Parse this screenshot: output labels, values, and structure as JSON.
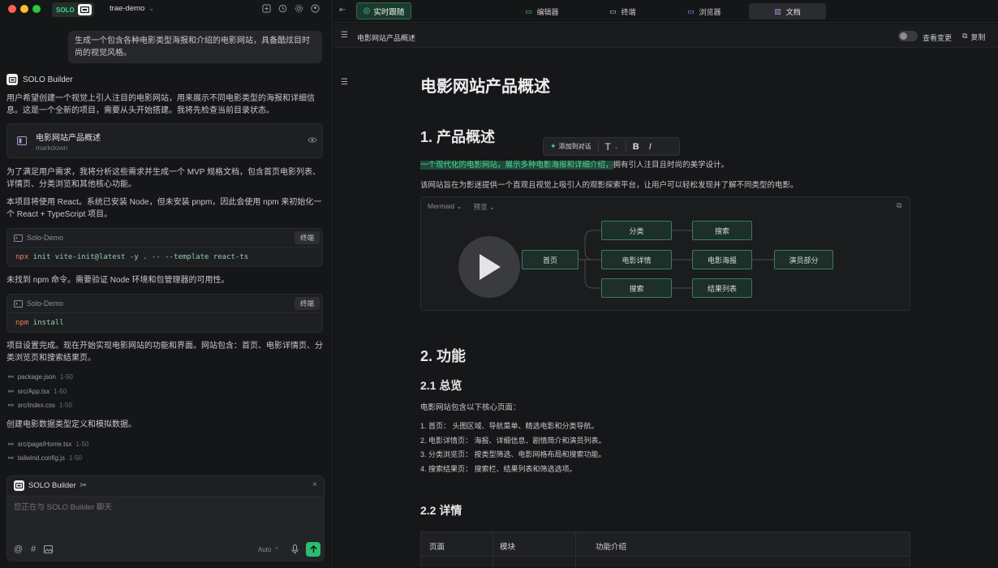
{
  "window": {
    "badge": "SOLO",
    "project": "trae-demo"
  },
  "chat": {
    "user_message": "生成一个包含各种电影类型海报和介绍的电影网站，具备酷炫目时尚的视觉风格。",
    "builder_name": "SOLO Builder",
    "msg1": "用户希望创建一个视觉上引人注目的电影网站，用来展示不同电影类型的海报和详细信息。这是一个全新的项目，需要从头开始搭建。我将先检查当前目录状态。",
    "doc_card": {
      "title": "电影网站产品概述",
      "sub": "markdown"
    },
    "msg2": "为了满足用户需求，我将分析这些需求并生成一个 MVP 规格文档，包含首页电影列表、详情页、分类浏览和其他核心功能。",
    "msg3": "本项目将使用 React。系统已安装 Node，但未安装 pnpm，因此会使用 npm 来初始化一个 React + TypeScript 项目。",
    "term1": {
      "name": "Solo-Demo",
      "btn": "终端",
      "cmd_a": "npx",
      "cmd_b": "init vite-init@latest -y . -- --template react-ts"
    },
    "msg4": "未找到 npm 命令。需要验证 Node 环境和包管理器的可用性。",
    "term2": {
      "name": "Solo-Demo",
      "btn": "终端",
      "cmd_a": "npm",
      "cmd_b": "install"
    },
    "msg5": "项目设置完成。现在开始实现电影网站的功能和界面。网站包含：首页、电影详情页、分类浏览页和搜索结果页。",
    "files1": [
      {
        "name": "package.json",
        "lines": "1-50"
      },
      {
        "name": "src/App.tsx",
        "lines": "1-50"
      },
      {
        "name": "src/index.css",
        "lines": "1-50"
      }
    ],
    "msg6": "创建电影数据类型定义和模拟数据。",
    "files2": [
      {
        "name": "src/page/Home.tsx",
        "lines": "1-50"
      },
      {
        "name": "tailwind.config.js",
        "lines": "1-50"
      }
    ],
    "composer": {
      "agent": "SOLO Builder",
      "placeholder": "您正在与 SOLO Builder 聊天",
      "mode": "Auto"
    }
  },
  "right": {
    "live_btn": "实时跟随",
    "tabs": [
      "编辑器",
      "终端",
      "浏览器",
      "文档"
    ],
    "active_tab": 3,
    "doc_title": "电影网站产品概述",
    "view_changes": "查看变更",
    "copy": "复制"
  },
  "doc": {
    "h1": "电影网站产品概述",
    "s1": "1. 产品概述",
    "toolbar": {
      "add": "添加到对话",
      "t": "T",
      "b": "B",
      "i": "I"
    },
    "p1_highlight": "一个现代化的电影网站，展示多种电影海报和详细介绍，",
    "p1_rest": "拥有引人注目且时尚的美学设计。",
    "p2": "该网站旨在为影迷提供一个直观且视觉上吸引人的观影探索平台，让用户可以轻松发现并了解不同类型的电影。",
    "mermaid": {
      "label": "Mermaid",
      "preview": "预览",
      "nodes": {
        "home": "首页",
        "cat": "分类",
        "detail": "电影详情",
        "search": "搜索",
        "search2": "搜索",
        "poster": "电影海报",
        "cast": "演员部分",
        "results": "结果列表"
      }
    },
    "s2": "2. 功能",
    "s21": "2.1 总览",
    "p3": "电影网站包含以下核心页面：",
    "list": [
      "1. 首页： 头图区域、导航菜单、精选电影和分类导航。",
      "2. 电影详情页： 海报、详细信息、剧情简介和演员列表。",
      "3. 分类浏览页： 按类型筛选、电影网格布局和搜索功能。",
      "4. 搜索结果页： 搜索栏、结果列表和筛选选项。"
    ],
    "s22": "2.2 详情",
    "table_headers": [
      "页面",
      "模块",
      "功能介绍"
    ]
  },
  "colors": {
    "accent": "#1f8a5c",
    "highlight": "#1f4a3a",
    "node_border": "#3d7a63"
  }
}
